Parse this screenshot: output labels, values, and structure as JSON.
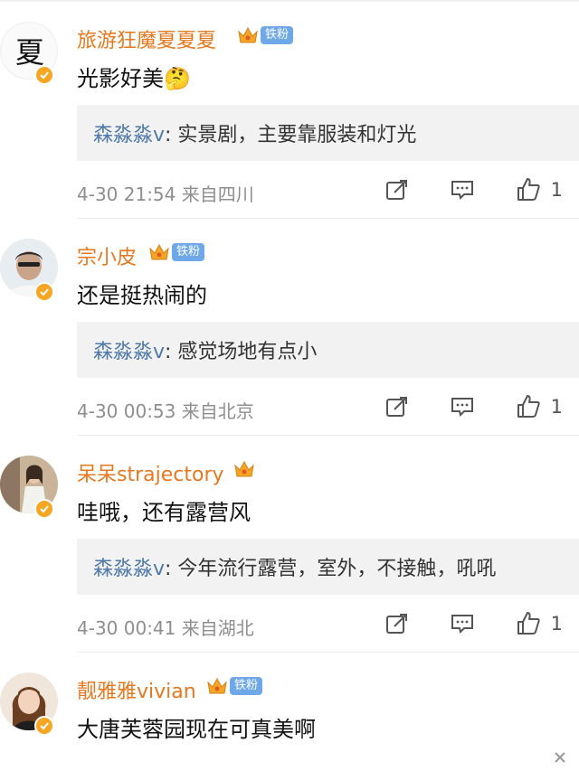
{
  "comments": [
    {
      "username": "旅游狂魔夏夏夏",
      "fan_badge": "铁粉",
      "text": "光影好美🤔",
      "reply_name": "森淼淼v",
      "reply_text": ": 实景剧，主要靠服装和灯光",
      "meta": "4-30 21:54  来自四川",
      "likes": "1",
      "avatar_char": "夏"
    },
    {
      "username": "宗小皮",
      "fan_badge": "铁粉",
      "text": "还是挺热闹的",
      "reply_name": "森淼淼v",
      "reply_text": ": 感觉场地有点小",
      "meta": "4-30 00:53  来自北京",
      "likes": "1"
    },
    {
      "username": "呆呆strajectory",
      "text": "哇哦，还有露营风",
      "reply_name": "森淼淼v",
      "reply_text": ": 今年流行露营，室外，不接触，吼吼",
      "meta": "4-30 00:41  来自湖北",
      "likes": "1"
    },
    {
      "username": "靓雅雅vivian",
      "fan_badge": "铁粉",
      "text": "大唐芙蓉园现在可真美啊"
    }
  ],
  "colors": {
    "username": "#e5781e",
    "reply_name": "#4f7aa8",
    "fan_badge": "#6ea8e8",
    "verified": "#f5a623"
  },
  "icons": [
    "crown-icon",
    "verified-icon",
    "share-icon",
    "comment-icon",
    "like-icon"
  ]
}
